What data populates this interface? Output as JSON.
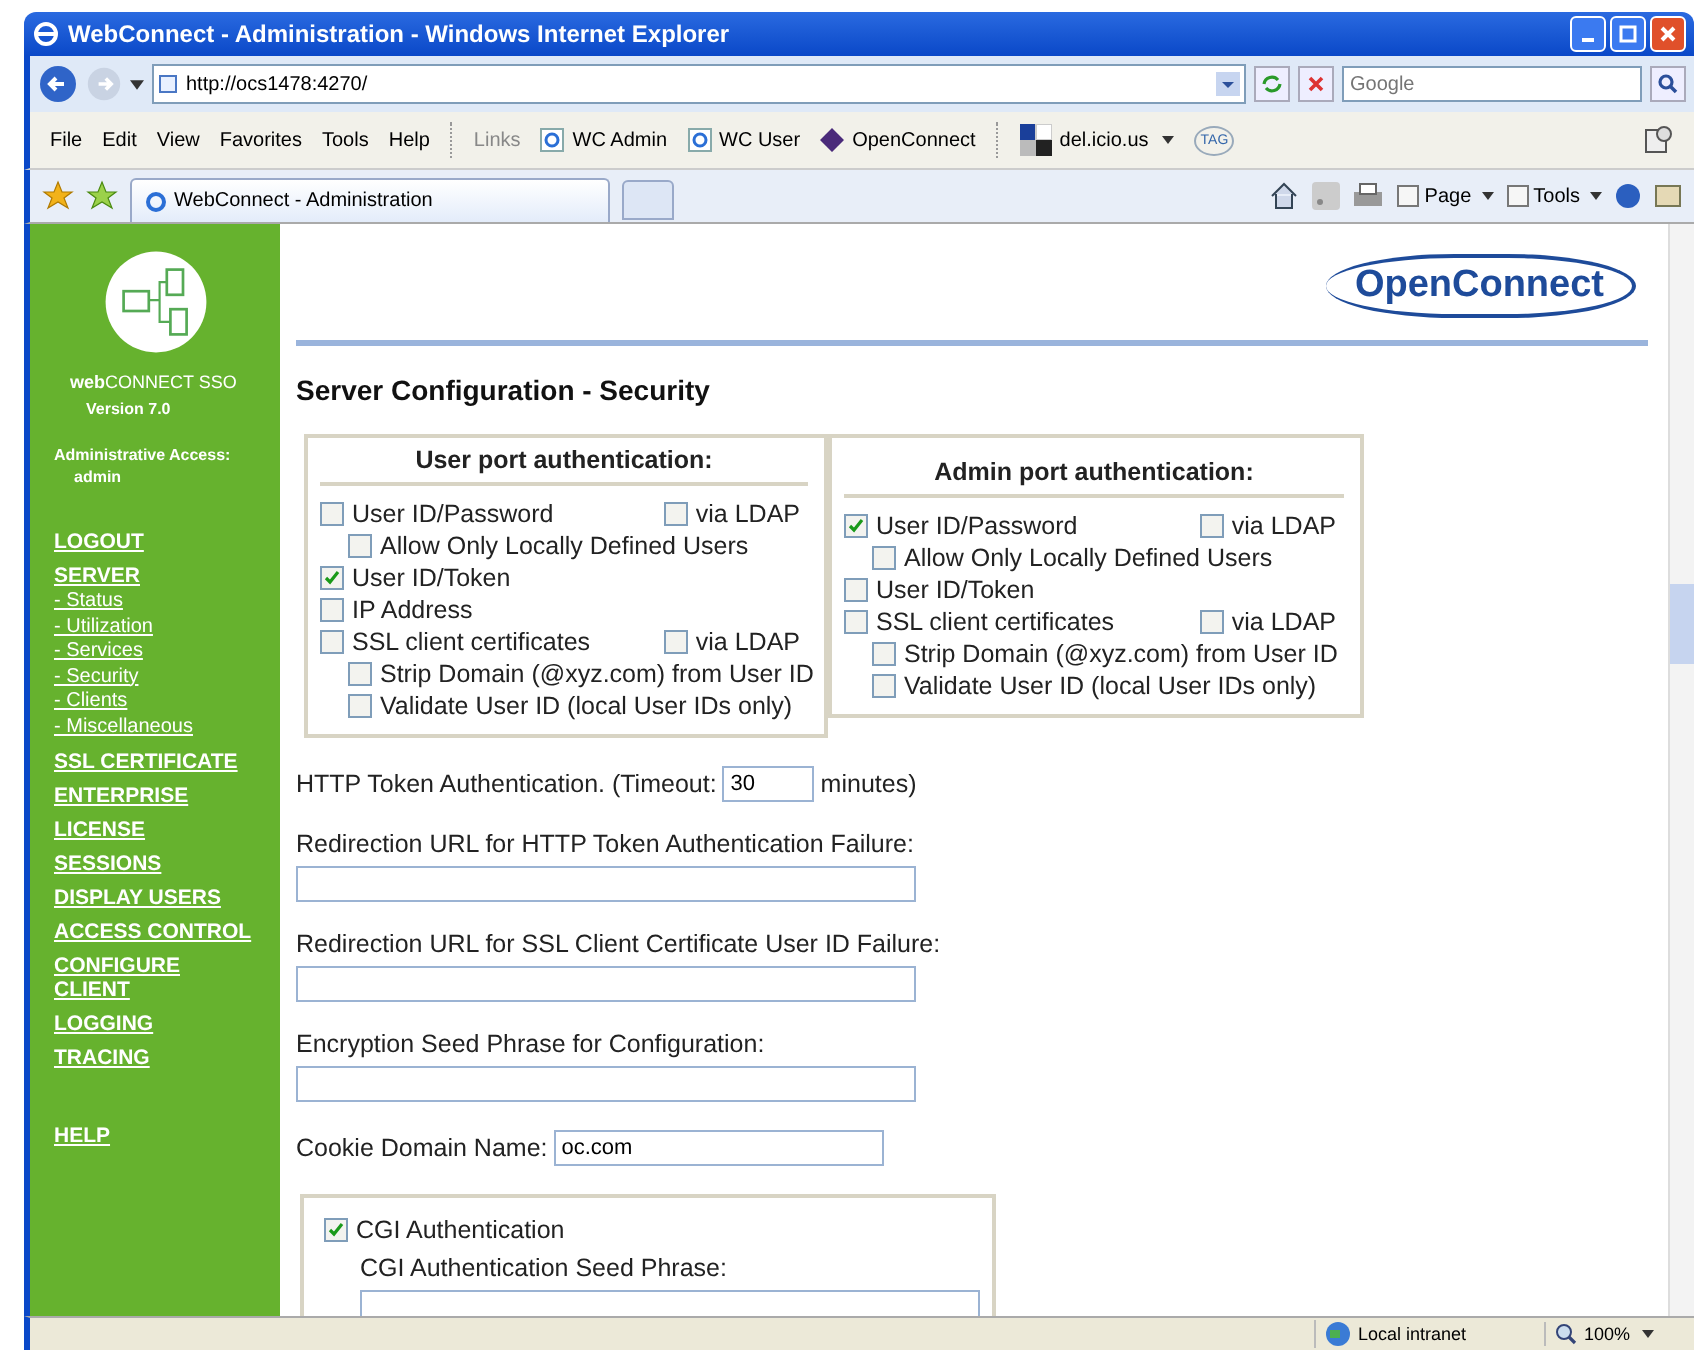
{
  "window": {
    "title": "WebConnect - Administration - Windows Internet Explorer"
  },
  "address_bar": {
    "url": "http://ocs1478:4270/"
  },
  "search": {
    "placeholder": "Google"
  },
  "menu": [
    "File",
    "Edit",
    "View",
    "Favorites",
    "Tools",
    "Help"
  ],
  "links_label": "Links",
  "links": [
    {
      "label": "WC Admin",
      "kind": "ie"
    },
    {
      "label": "WC User",
      "kind": "ie"
    },
    {
      "label": "OpenConnect",
      "kind": "brand"
    }
  ],
  "delicious": {
    "label": "del.icio.us",
    "tag": "TAG"
  },
  "tab": {
    "title": "WebConnect - Administration"
  },
  "commands": [
    "Page",
    "Tools"
  ],
  "sidebar": {
    "product": "**web**CONNECT SSO",
    "version": "Version 7.0",
    "access_label": "Administrative Access:",
    "user": "admin",
    "nav": [
      {
        "label": "LOGOUT"
      },
      {
        "label": "SERVER",
        "children": [
          "- Status",
          "- Utilization",
          "- Services",
          "- Security",
          "- Clients",
          "- Miscellaneous"
        ]
      },
      {
        "label": "SSL CERTIFICATE"
      },
      {
        "label": "ENTERPRISE"
      },
      {
        "label": "LICENSE"
      },
      {
        "label": "SESSIONS"
      },
      {
        "label": "DISPLAY USERS"
      },
      {
        "label": "ACCESS CONTROL"
      },
      {
        "label": "CONFIGURE CLIENT"
      },
      {
        "label": "LOGGING"
      },
      {
        "label": "TRACING"
      }
    ],
    "help": "HELP"
  },
  "logo": "OpenConnect",
  "heading": "Server Configuration - Security",
  "panels": [
    {
      "title": "User port authentication:",
      "options": [
        {
          "label": "User ID/Password",
          "checked": false,
          "ldap": {
            "label": "via LDAP",
            "checked": false
          },
          "children": [
            {
              "label": "Allow Only Locally Defined Users",
              "checked": false
            }
          ]
        },
        {
          "label": "User ID/Token",
          "checked": true
        },
        {
          "label": "IP Address",
          "checked": false
        },
        {
          "label": "SSL client certificates",
          "checked": false,
          "ldap": {
            "label": "via LDAP",
            "checked": false
          },
          "children": [
            {
              "label": "Strip Domain (@xyz.com) from User ID",
              "checked": false
            },
            {
              "label": "Validate User ID (local User IDs only)",
              "checked": false
            }
          ]
        }
      ]
    },
    {
      "title": "Admin port authentication:",
      "options": [
        {
          "label": "User ID/Password",
          "checked": true,
          "ldap": {
            "label": "via LDAP",
            "checked": false
          },
          "children": [
            {
              "label": "Allow Only Locally Defined Users",
              "checked": false
            }
          ]
        },
        {
          "label": "User ID/Token",
          "checked": false
        },
        {
          "label": "SSL client certificates",
          "checked": false,
          "ldap": {
            "label": "via LDAP",
            "checked": false
          },
          "children": [
            {
              "label": "Strip Domain (@xyz.com) from User ID",
              "checked": false
            },
            {
              "label": "Validate User ID (local User IDs only)",
              "checked": false
            }
          ]
        }
      ]
    }
  ],
  "fields": [
    {
      "kind": "timeout",
      "label": "HTTP Token Authentication. (Timeout:",
      "value": "30",
      "suffix": "minutes)"
    },
    {
      "kind": "stacked",
      "label": "Redirection URL for HTTP Token Authentication Failure:"
    },
    {
      "kind": "stacked",
      "label": "Redirection URL for SSL Client Certificate User ID Failure:"
    },
    {
      "kind": "stacked",
      "label": "Encryption Seed Phrase for Configuration:"
    },
    {
      "kind": "inline",
      "label": "Cookie Domain Name:",
      "value": "oc.com"
    }
  ],
  "cgi": {
    "label": "CGI Authentication",
    "checked": true,
    "seed_label": "CGI Authentication Seed Phrase:"
  },
  "status_bar": {
    "zone": "Local intranet",
    "zoom": "100%"
  }
}
